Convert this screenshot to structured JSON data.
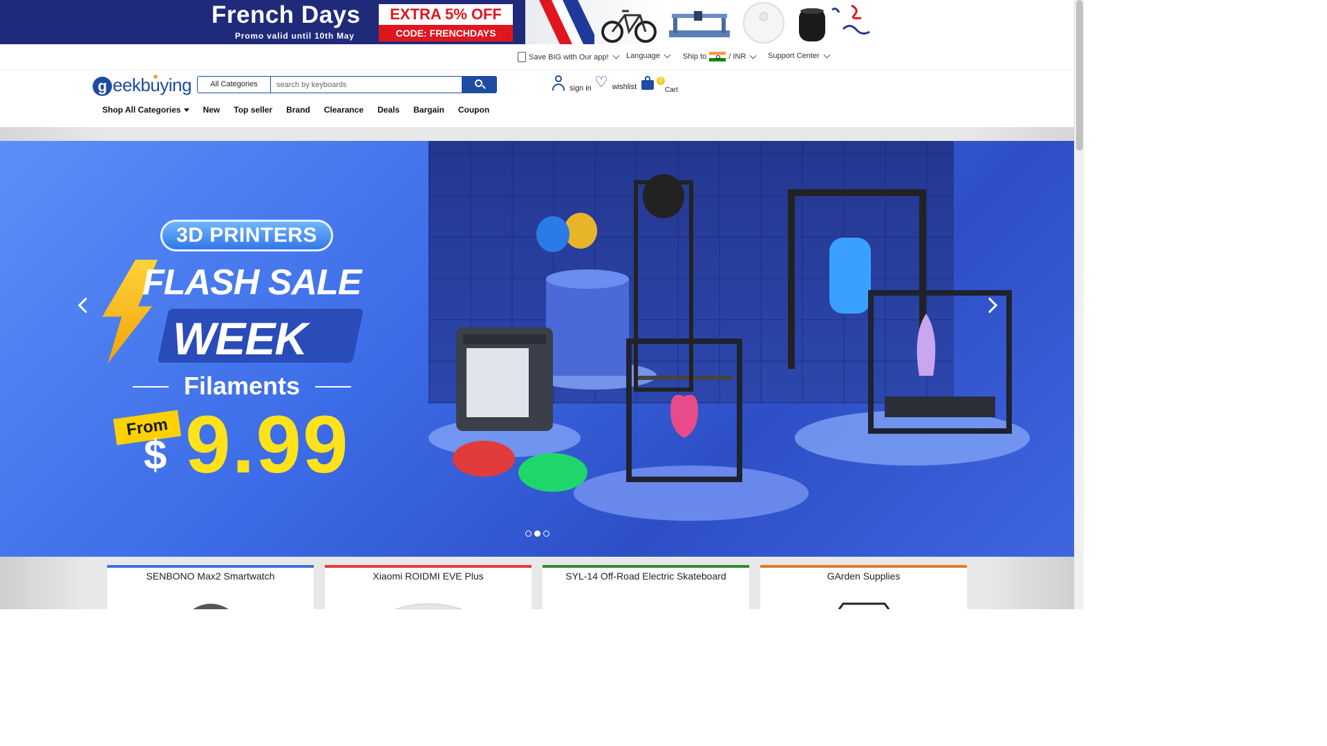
{
  "promo": {
    "title": "French Days",
    "subtitle": "Promo valid until 10th May",
    "offer": "EXTRA 5% OFF",
    "code": "CODE: FRENCHDAYS",
    "colors": {
      "bg": "#1f2a7a",
      "accent": "#e0161f"
    }
  },
  "utility": {
    "app": "Save BIG with Our app!",
    "language": "Language",
    "ship_to": "Ship to",
    "currency": "/ INR",
    "support": "Support Center"
  },
  "header": {
    "logo_text": "eekbuying",
    "logo_g": "g",
    "search": {
      "category": "All Categories",
      "placeholder": "search by keyboards"
    },
    "sign_in": "sign in",
    "wishlist": "wishlist",
    "cart": "Cart",
    "cart_count": "0"
  },
  "nav": {
    "shop_all": "Shop All Categories",
    "items": [
      "New",
      "Top seller",
      "Brand",
      "Clearance",
      "Deals",
      "Bargain",
      "Coupon"
    ]
  },
  "hero": {
    "pill": "3D PRINTERS",
    "flash": "FLASH SALE",
    "week": "WEEK",
    "filaments": "Filaments",
    "from": "From",
    "dollar": "$",
    "price": "9.99",
    "slide_count": 3,
    "active_slide": 2
  },
  "cards": [
    {
      "title": "SENBONO Max2 Smartwatch",
      "color": "#3a6fe0"
    },
    {
      "title": "Xiaomi ROIDMI EVE Plus",
      "color": "#e53935"
    },
    {
      "title": "SYL-14 Off-Road Electric Skateboard",
      "color": "#2e8b2e"
    },
    {
      "title": "GArden Supplies",
      "color": "#e07a2a"
    }
  ]
}
